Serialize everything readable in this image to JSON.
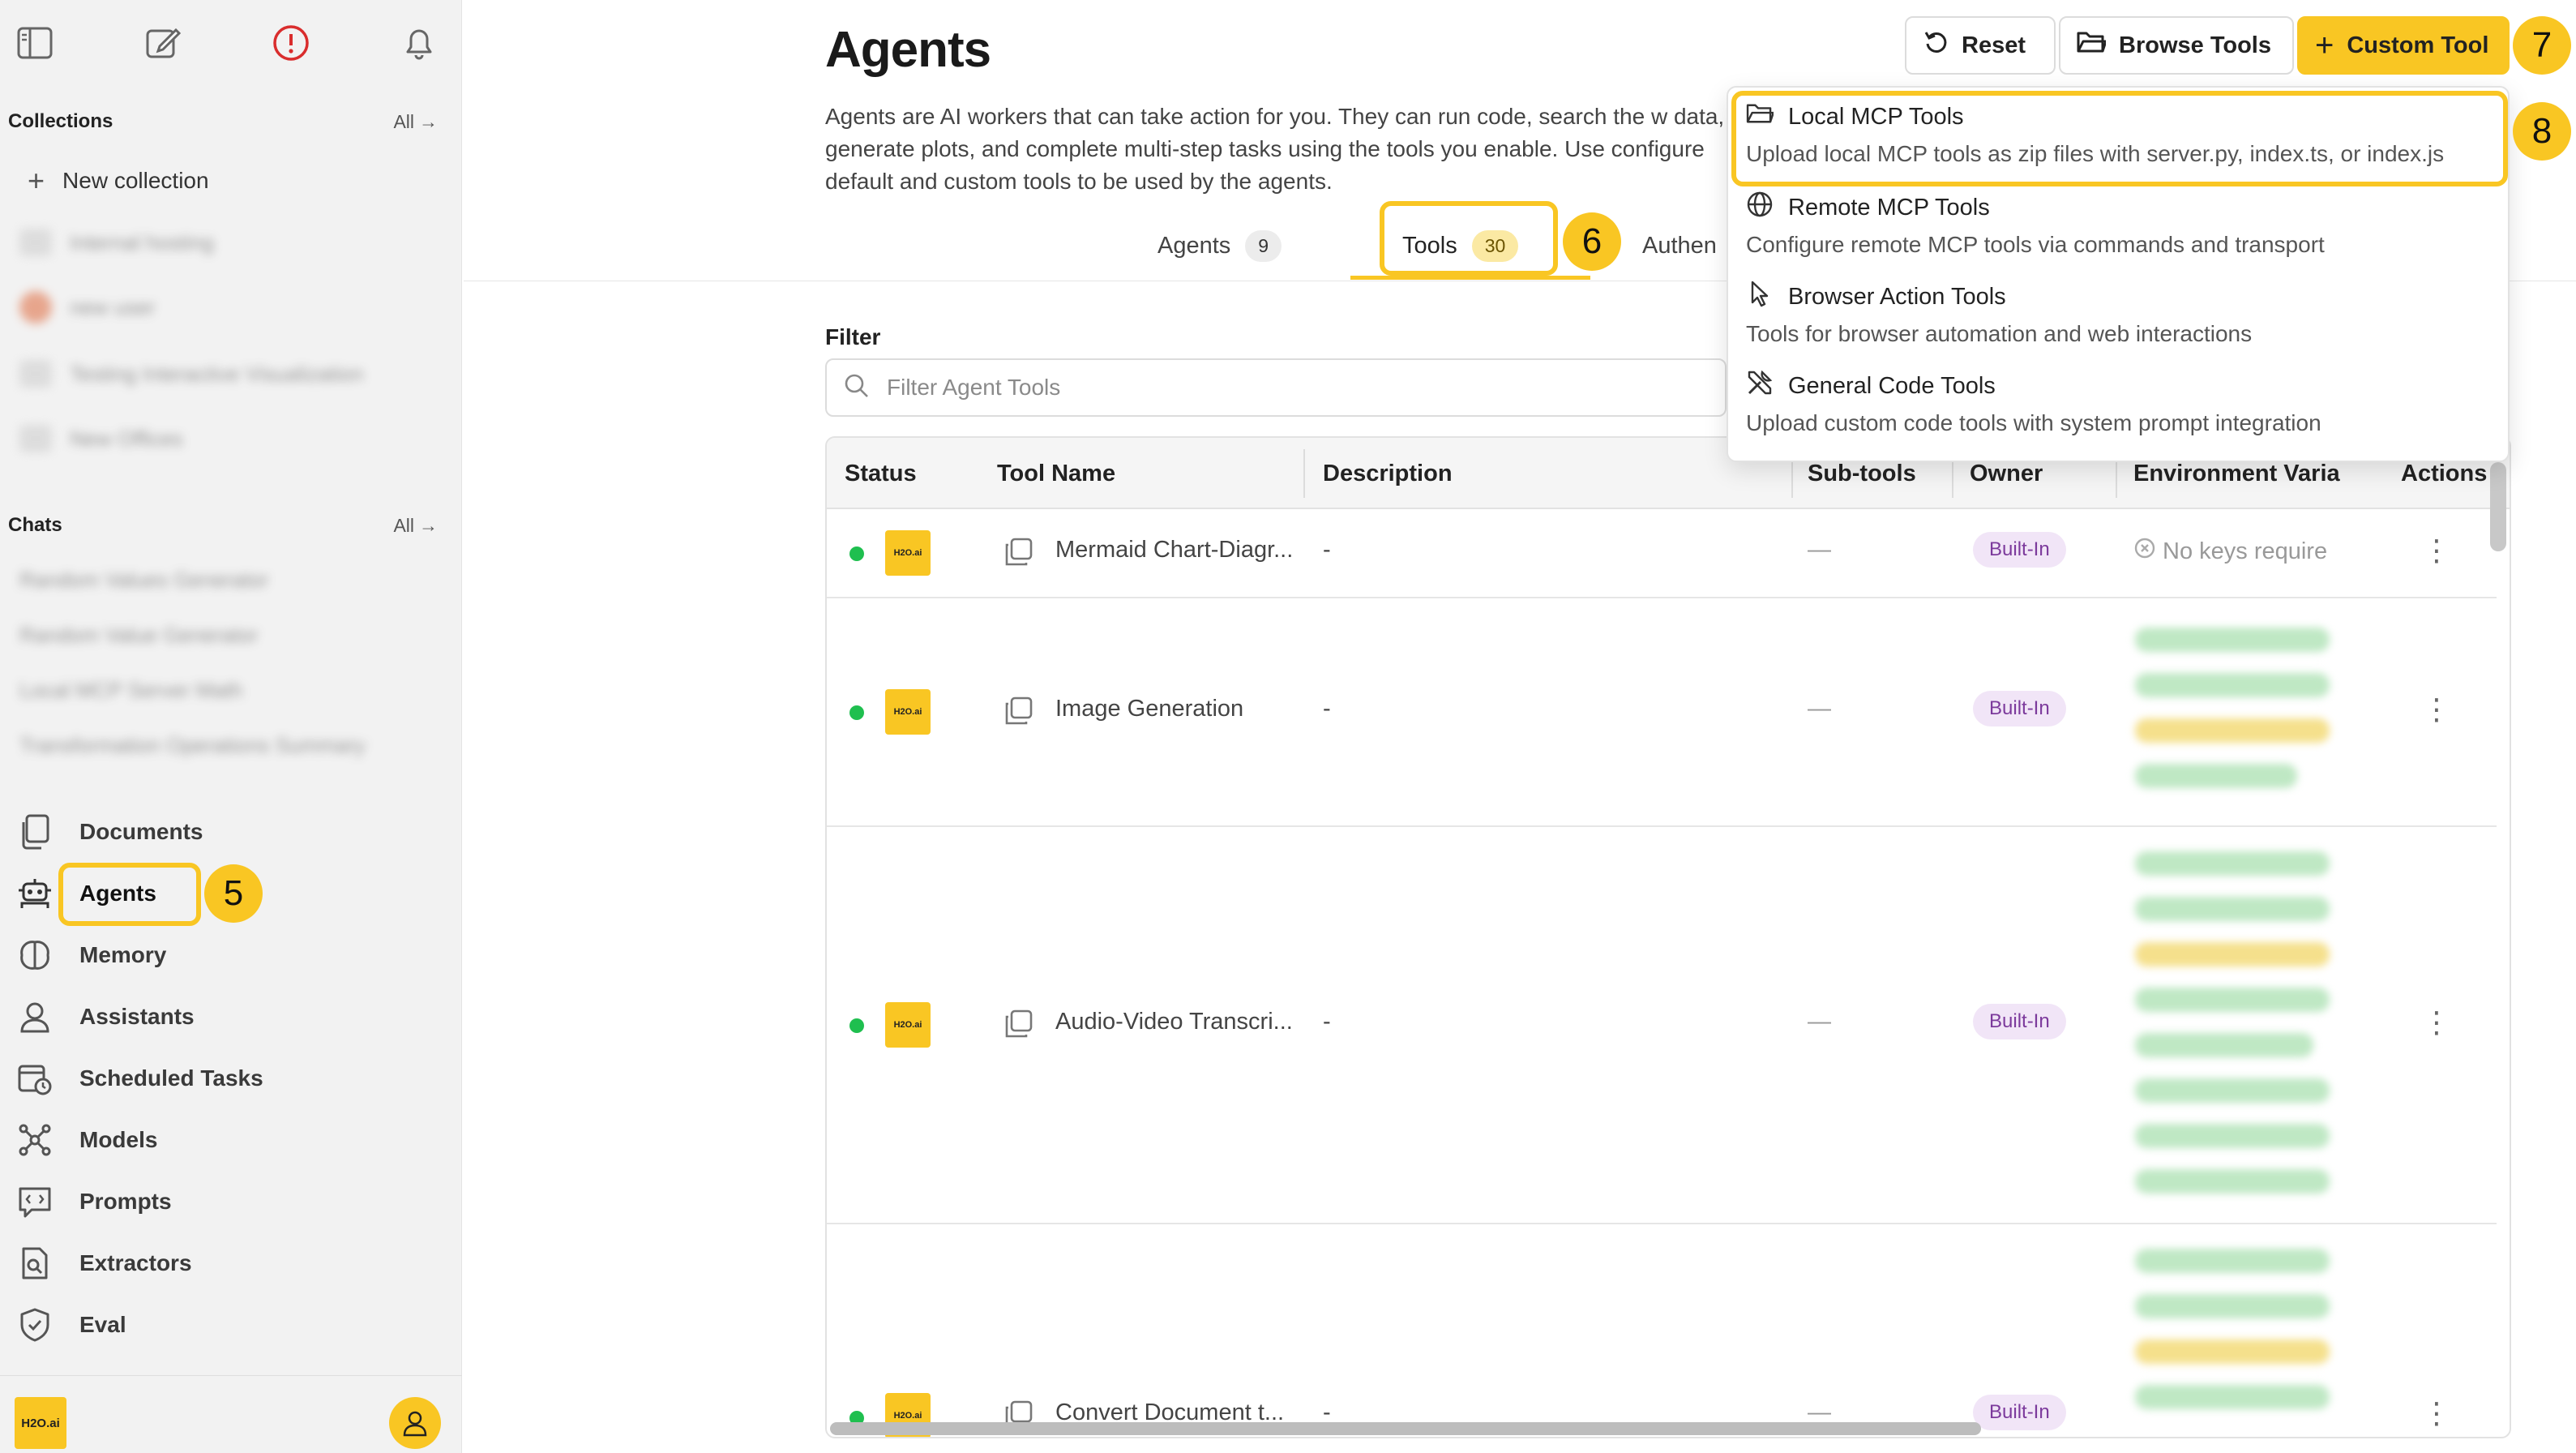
{
  "sidebar": {
    "collections_label": "Collections",
    "collections_all": "All",
    "new_collection": "New collection",
    "blurred_collections": [
      "Internal hosting",
      "new user",
      "Testing Interactive Visualization",
      "New Offices"
    ],
    "chats_label": "Chats",
    "chats_all": "All",
    "blurred_chats": [
      "Random Values Generator",
      "Random Value Generator",
      "Local MCP Server Math",
      "Transformation Operations Summary"
    ],
    "nav": [
      {
        "label": "Documents",
        "icon": "documents-icon"
      },
      {
        "label": "Agents",
        "icon": "robot-icon"
      },
      {
        "label": "Memory",
        "icon": "brain-icon"
      },
      {
        "label": "Assistants",
        "icon": "assistant-icon"
      },
      {
        "label": "Scheduled Tasks",
        "icon": "calendar-clock-icon"
      },
      {
        "label": "Models",
        "icon": "models-icon"
      },
      {
        "label": "Prompts",
        "icon": "prompt-icon"
      },
      {
        "label": "Extractors",
        "icon": "extractor-icon"
      },
      {
        "label": "Eval",
        "icon": "shield-check-icon"
      }
    ],
    "logo_text": "H2O.ai"
  },
  "header": {
    "title": "Agents",
    "description": "Agents are AI workers that can take action for you. They can run code, search the w data, generate plots, and complete multi-step tasks using the tools you enable. Use configure default and custom tools to be used by the agents.",
    "reset": "Reset",
    "browse_tools": "Browse Tools",
    "custom_tool": "Custom Tool"
  },
  "tabs": [
    {
      "label": "Agents",
      "count": "9"
    },
    {
      "label": "Tools",
      "count": "30"
    },
    {
      "label": "Authen"
    }
  ],
  "steps": {
    "five": "5",
    "six": "6",
    "seven": "7",
    "eight": "8"
  },
  "filter": {
    "label": "Filter",
    "placeholder": "Filter Agent Tools"
  },
  "table": {
    "columns": [
      "Status",
      "Tool Name",
      "Description",
      "Sub-tools",
      "Owner",
      "Environment Varia",
      "Actions"
    ],
    "rows": [
      {
        "name": "Mermaid Chart-Diagr...",
        "description": "-",
        "subtools": "—",
        "owner": "Built-In",
        "env": "No keys require",
        "logo": "H2O.ai"
      },
      {
        "name": "Image Generation",
        "description": "-",
        "subtools": "—",
        "owner": "Built-In",
        "env": "",
        "logo": "H2O.ai"
      },
      {
        "name": "Audio-Video Transcri...",
        "description": "-",
        "subtools": "—",
        "owner": "Built-In",
        "env": "",
        "logo": "H2O.ai"
      },
      {
        "name": "Convert Document t...",
        "description": "-",
        "subtools": "—",
        "owner": "Built-In",
        "env": "",
        "logo": "H2O.ai"
      }
    ]
  },
  "dropdown": [
    {
      "title": "Local MCP Tools",
      "desc": "Upload local MCP tools as zip files with server.py, index.ts, or index.js",
      "icon": "folder-open-icon"
    },
    {
      "title": "Remote MCP Tools",
      "desc": "Configure remote MCP tools via commands and transport",
      "icon": "globe-icon"
    },
    {
      "title": "Browser Action Tools",
      "desc": "Tools for browser automation and web interactions",
      "icon": "cursor-icon"
    },
    {
      "title": "General Code Tools",
      "desc": "Upload custom code tools with system prompt integration",
      "icon": "tools-icon"
    }
  ],
  "colors": {
    "accent": "#f9c623",
    "status_active": "#1fbf4f",
    "badge_bg": "#f1e5f7",
    "badge_text": "#7c3a9c"
  }
}
